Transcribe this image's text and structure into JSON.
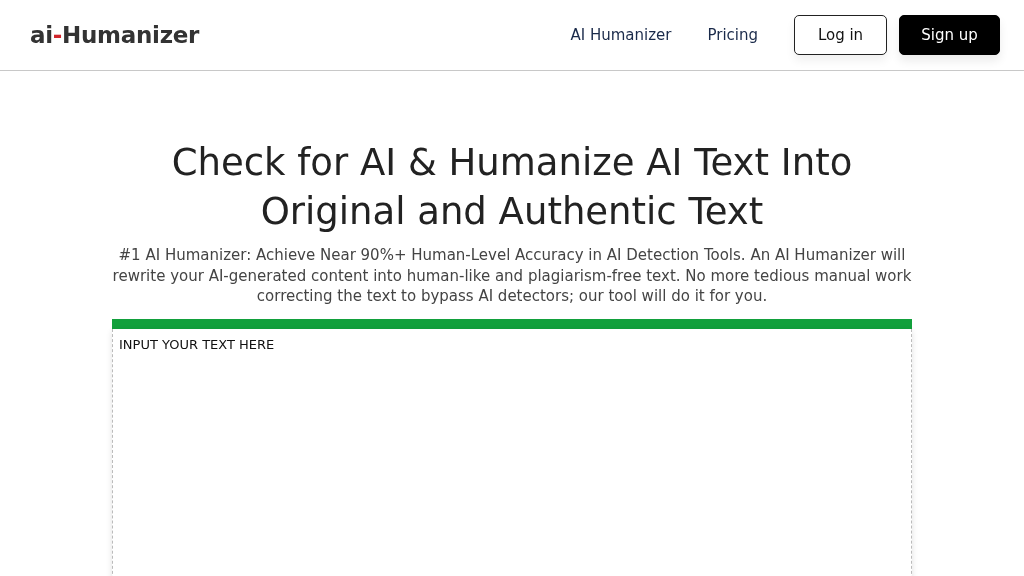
{
  "header": {
    "logo": {
      "prefix": "ai",
      "separator": "-",
      "name": "Humanizer"
    },
    "nav": [
      {
        "label": "AI Humanizer",
        "kind": "link"
      },
      {
        "label": "Pricing",
        "kind": "link"
      },
      {
        "label": "Log in",
        "kind": "outline"
      },
      {
        "label": "Sign up",
        "kind": "solid"
      }
    ]
  },
  "hero": {
    "title": "Check for AI & Humanize AI Text Into Original and Authentic Text",
    "description": "#1 AI Humanizer: Achieve Near 90%+ Human-Level Accuracy in AI Detection Tools. An AI Humanizer will rewrite your AI-generated content into human-like and plagiarism-free text. No more tedious manual work correcting the text to bypass AI detectors; our tool will do it for you."
  },
  "editor": {
    "placeholder": "INPUT YOUR TEXT HERE"
  }
}
